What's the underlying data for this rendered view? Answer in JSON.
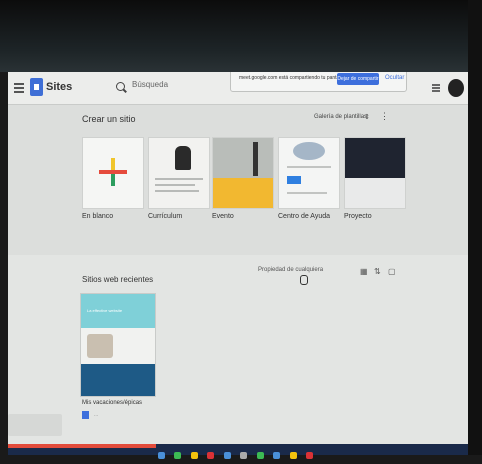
{
  "header": {
    "app_title": "Sites",
    "search_placeholder": "Búsqueda",
    "share_notice": {
      "message": "meet.google.com está compartiendo tu pantalla.",
      "stop_label": "Dejar de compartir",
      "hide_label": "Ocultar"
    }
  },
  "create": {
    "title": "Crear un sitio",
    "gallery_label": "Galería de plantillas",
    "templates": [
      {
        "label": "En blanco"
      },
      {
        "label": "Currículum"
      },
      {
        "label": "Evento"
      },
      {
        "label": "Centro de Ayuda"
      },
      {
        "label": "Proyecto"
      }
    ]
  },
  "recent": {
    "title": "Sitios web recientes",
    "owner_filter": "Propiedad de cualquiera",
    "site": {
      "hero_text": "La effective website",
      "name": "Mis vacaciones/épicas",
      "date": "..."
    }
  },
  "colors": {
    "accent": "#3d6fdc",
    "recording": "#e24b3b",
    "taskbar": "#1a2a4a"
  }
}
